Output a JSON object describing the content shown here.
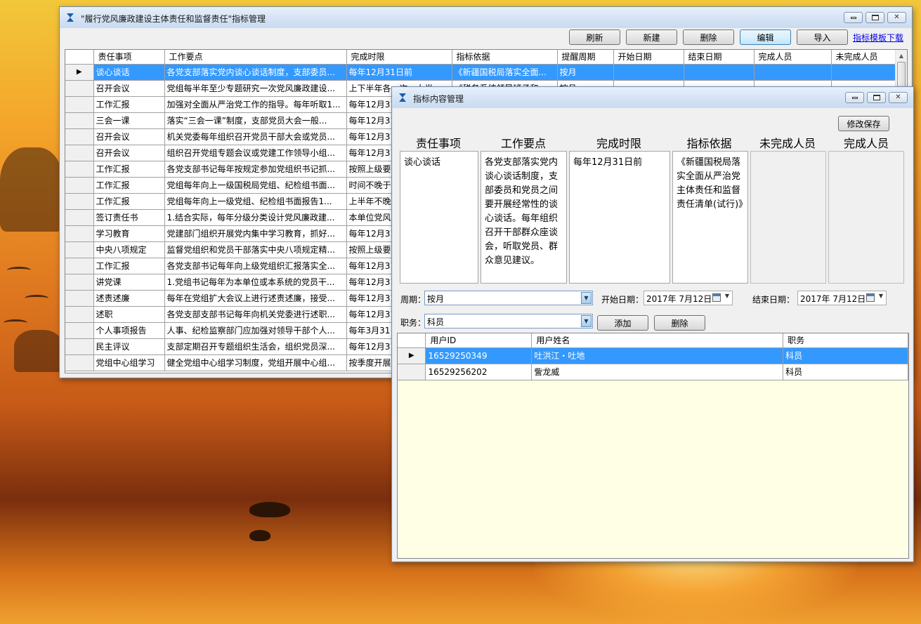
{
  "main_window": {
    "title": "\"履行党风廉政建设主体责任和监督责任\"指标管理",
    "toolbar": {
      "refresh": "刷新",
      "new": "新建",
      "delete": "删除",
      "edit": "编辑",
      "import": "导入",
      "template_link": "指标模板下载"
    },
    "columns": [
      "责任事项",
      "工作要点",
      "完成时限",
      "指标依据",
      "提醒周期",
      "开始日期",
      "结束日期",
      "完成人员",
      "未完成人员"
    ],
    "rows": [
      [
        "谈心谈话",
        "各党支部落实党内谈心谈话制度，支部委员...",
        "每年12月31日前",
        "《新疆国税局落实全面...",
        "按月",
        "",
        "",
        "",
        ""
      ],
      [
        "召开会议",
        "党组每半年至少专题研究一次党风廉政建设...",
        "上下半年各一次，上半...",
        "《税务系统领导班子和...",
        "按月",
        "",
        "",
        "",
        ""
      ],
      [
        "工作汇报",
        "加强对全面从严治党工作的指导。每年听取1...",
        "每年12月31...",
        "",
        "",
        "",
        "",
        "",
        ""
      ],
      [
        "三会一课",
        "落实“三会一课”制度，支部党员大会一般...",
        "每年12月31...",
        "",
        "",
        "",
        "",
        "",
        ""
      ],
      [
        "召开会议",
        "机关党委每年组织召开党员干部大会或党员...",
        "每年12月31...",
        "",
        "",
        "",
        "",
        "",
        ""
      ],
      [
        "召开会议",
        "组织召开党组专题会议或党建工作领导小组...",
        "每年12月31...",
        "",
        "",
        "",
        "",
        "",
        ""
      ],
      [
        "工作汇报",
        "各党支部书记每年按规定参加党组织书记抓...",
        "按照上级要...",
        "",
        "",
        "",
        "",
        "",
        ""
      ],
      [
        "工作汇报",
        "党组每年向上一级国税局党组、纪检组书面...",
        "时间不晚于...",
        "",
        "",
        "",
        "",
        "",
        ""
      ],
      [
        "工作汇报",
        "党组每年向上一级党组、纪检组书面报告1...",
        "上半年不晚...",
        "",
        "",
        "",
        "",
        "",
        ""
      ],
      [
        "签订责任书",
        "1.结合实际，每年分级分类设计党风廉政建...",
        "本单位党风...",
        "",
        "",
        "",
        "",
        "",
        ""
      ],
      [
        "学习教育",
        "党建部门组织开展党内集中学习教育，抓好...",
        "每年12月31...",
        "",
        "",
        "",
        "",
        "",
        ""
      ],
      [
        "中央八项规定",
        "监督党组织和党员干部落实中央八项规定精...",
        "按照上级要...",
        "",
        "",
        "",
        "",
        "",
        ""
      ],
      [
        "工作汇报",
        "各党支部书记每年向上级党组织汇报落实全...",
        "每年12月31...",
        "",
        "",
        "",
        "",
        "",
        ""
      ],
      [
        "讲党课",
        "1.党组书记每年为本单位或本系统的党员干...",
        "每年12月31...",
        "",
        "",
        "",
        "",
        "",
        ""
      ],
      [
        "述责述廉",
        "每年在党组扩大会议上进行述责述廉，接受...",
        "每年12月31...",
        "",
        "",
        "",
        "",
        "",
        ""
      ],
      [
        "述职",
        "各党支部支部书记每年向机关党委进行述职...",
        "每年12月31...",
        "",
        "",
        "",
        "",
        "",
        ""
      ],
      [
        "个人事项报告",
        "人事、纪检监察部门应加强对领导干部个人...",
        "每年3月31日...",
        "",
        "",
        "",
        "",
        "",
        ""
      ],
      [
        "民主评议",
        "支部定期召开专题组织生活会，组织党员深...",
        "每年12月31...",
        "",
        "",
        "",
        "",
        "",
        ""
      ],
      [
        "党组中心组学习",
        "健全党组中心组学习制度，党组开展中心组...",
        "按季度开展...",
        "",
        "",
        "",
        "",
        "",
        ""
      ]
    ]
  },
  "detail_window": {
    "title": "指标内容管理",
    "save_button": "修改保存",
    "headers": {
      "item": "责任事项",
      "points": "工作要点",
      "deadline": "完成时限",
      "basis": "指标依据",
      "unfinished": "未完成人员",
      "finished": "完成人员"
    },
    "values": {
      "item": "谈心谈话",
      "points": "各党支部落实党内谈心谈话制度，支部委员和党员之间要开展经常性的谈心谈话。每年组织召开干部群众座谈会，听取党员、群众意见建议。",
      "deadline": "每年12月31日前",
      "basis": "《新疆国税局落实全面从严治党主体责任和监督责任清单(试行)》",
      "unfinished": "",
      "finished": ""
    },
    "period_label": "周期：",
    "period_value": "按月",
    "start_label": "开始日期：",
    "start_value": "2017年  7月12日",
    "end_label": "结束日期：",
    "end_value": "2017年  7月12日",
    "position_label": "职务：",
    "position_value": "科员",
    "add_button": "添加",
    "delete_button": "删除",
    "user_columns": [
      "用户ID",
      "用户姓名",
      "职务"
    ],
    "users": [
      [
        "16529250349",
        "吐洪江・吐地",
        "科员"
      ],
      [
        "16529256202",
        "訾龙威",
        "科员"
      ]
    ]
  },
  "colors": {
    "selection": "#3399ff",
    "grid_background": "#ffffe5",
    "link": "#0000ee"
  }
}
